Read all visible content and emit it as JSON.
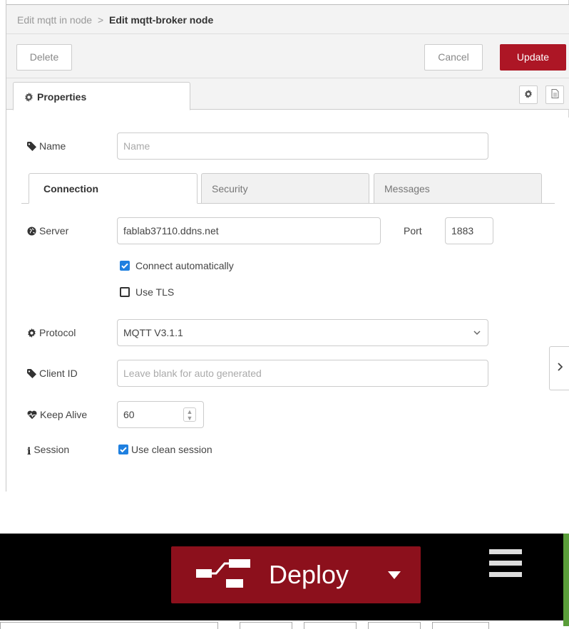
{
  "breadcrumb": {
    "parent": "Edit mqtt in node",
    "separator": ">",
    "current": "Edit mqtt-broker node"
  },
  "toolbar": {
    "delete_label": "Delete",
    "cancel_label": "Cancel",
    "update_label": "Update"
  },
  "tabs": {
    "properties_label": "Properties"
  },
  "form": {
    "name": {
      "label": "Name",
      "value": "",
      "placeholder": "Name"
    },
    "subtabs": [
      "Connection",
      "Security",
      "Messages"
    ],
    "server": {
      "label": "Server",
      "value": "fablab37110.ddns.net"
    },
    "port": {
      "label": "Port",
      "value": "1883"
    },
    "connect_auto": {
      "label": "Connect automatically",
      "checked": true
    },
    "use_tls": {
      "label": "Use TLS",
      "checked": false
    },
    "protocol": {
      "label": "Protocol",
      "value": "MQTT V3.1.1"
    },
    "client_id": {
      "label": "Client ID",
      "value": "",
      "placeholder": "Leave blank for auto generated"
    },
    "keep_alive": {
      "label": "Keep Alive",
      "value": "60"
    },
    "session": {
      "label": "Session",
      "option_label": "Use clean session",
      "checked": true
    }
  },
  "header": {
    "deploy_label": "Deploy",
    "icons": [
      "deploy-icon",
      "caret-down-icon",
      "menu-icon"
    ],
    "colors": {
      "background": "#000000",
      "deploy": "#8c101c",
      "accent": "#5a9e3a"
    }
  },
  "colors": {
    "update_button": "#ad1625",
    "checkbox": "#1f80e0"
  }
}
